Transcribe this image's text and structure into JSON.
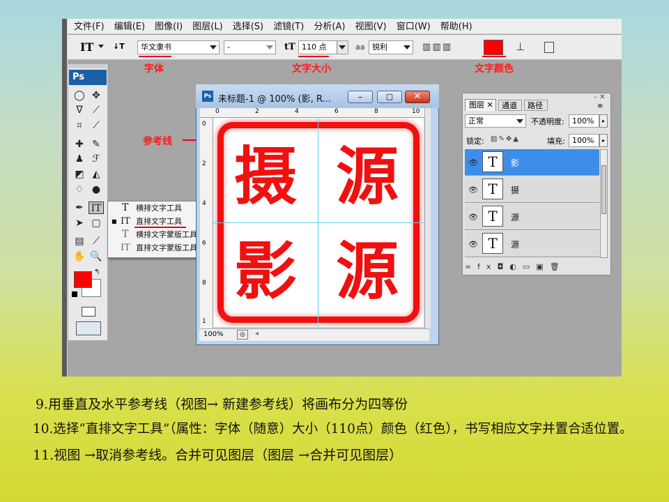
{
  "menu": [
    "文件(F)",
    "编辑(E)",
    "图像(I)",
    "图层(L)",
    "选择(S)",
    "滤镜(T)",
    "分析(A)",
    "视图(V)",
    "窗口(W)",
    "帮助(H)"
  ],
  "options": {
    "tool_icon": "IT",
    "font_family": "华文隶书",
    "font_style": "-",
    "font_size": "110 点",
    "aa_label": "aa",
    "antialias": "锐利",
    "text_color": "#ff0000"
  },
  "annotations": {
    "font": "字体",
    "size": "文字大小",
    "color": "文字颜色",
    "guide": "参考线"
  },
  "toolbox": {
    "logo": "Ps"
  },
  "flyout": {
    "items": [
      {
        "label": "横排文字工具",
        "key": "T"
      },
      {
        "label": "直排文字工具",
        "key": "T"
      },
      {
        "label": "横排文字蒙版工具",
        "key": "T"
      },
      {
        "label": "直排文字蒙版工具",
        "key": "T"
      }
    ]
  },
  "document": {
    "title": "未标题-1 @ 100% (影, R...",
    "zoom": "100%",
    "ruler_h": [
      "0",
      "2",
      "4",
      "6",
      "8",
      "10"
    ],
    "ruler_v": [
      "0",
      "2",
      "4",
      "6",
      "8",
      "1"
    ],
    "glyphs": [
      "摄",
      "源",
      "影",
      "源"
    ]
  },
  "layers_panel": {
    "tabs": [
      "图层",
      "通道",
      "路径"
    ],
    "blend_mode": "正常",
    "opacity_label": "不透明度:",
    "opacity": "100%",
    "lock_label": "锁定:",
    "fill_label": "填充:",
    "fill": "100%",
    "layers": [
      {
        "name": "影",
        "selected": true
      },
      {
        "name": "摄",
        "selected": false
      },
      {
        "name": "源",
        "selected": false
      },
      {
        "name": "源",
        "selected": false
      }
    ],
    "bottom_icons": [
      "link-icon",
      "fx-icon",
      "mask-icon",
      "adjustment-icon",
      "group-icon",
      "new-layer-icon",
      "trash-icon"
    ]
  },
  "instructions": [
    "9.用垂直及水平参考线（视图→ 新建参考线）将画布分为四等份",
    "10.选择“直排文字工具”（属性：字体（随意）大小（110点）颜色（红色），书写相应文字并置合适位置。",
    "11.视图 →取消参考线。合并可见图层（图层 →合并可见图层）"
  ]
}
